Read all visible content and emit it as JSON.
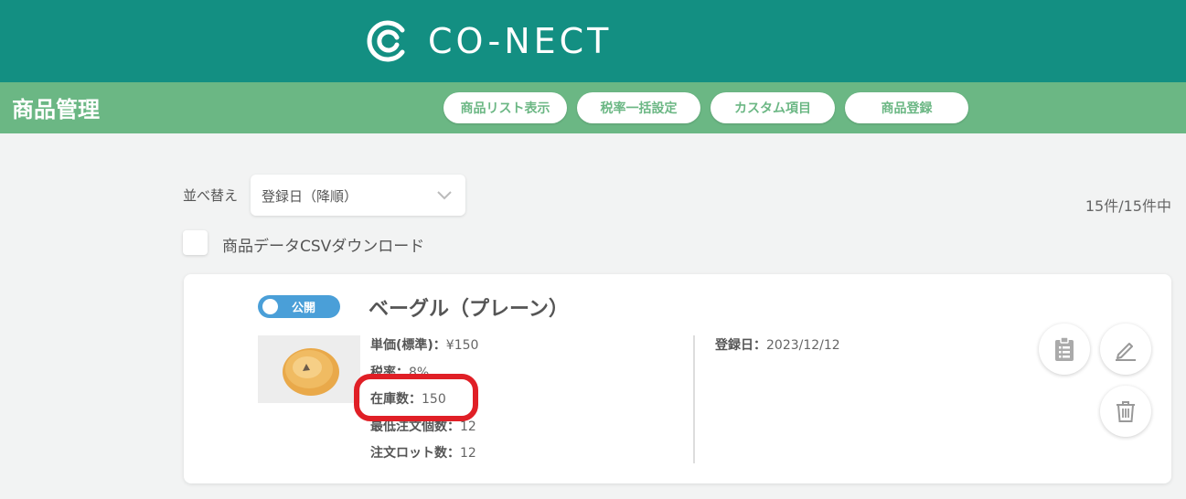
{
  "header": {
    "brand": "CO-NECT"
  },
  "subheader": {
    "title": "商品管理",
    "nav": [
      {
        "label": "商品リスト表示"
      },
      {
        "label": "税率一括設定"
      },
      {
        "label": "カスタム項目"
      },
      {
        "label": "商品登録"
      }
    ]
  },
  "toolbar": {
    "sort_label": "並べ替え",
    "sort_value": "登録日（降順）",
    "count": "15件/15件中",
    "csv_label": "商品データCSVダウンロード"
  },
  "product": {
    "status": "公開",
    "name": "ベーグル（プレーン）",
    "price_label": "単価(標準)：",
    "price_value": "¥150",
    "tax_label": "税率：",
    "tax_value": "8%",
    "stock_label": "在庫数：",
    "stock_value": "150",
    "min_order_label": "最低注文個数：",
    "min_order_value": "12",
    "lot_label": "注文ロット数：",
    "lot_value": "12",
    "reg_date_label": "登録日：",
    "reg_date_value": "2023/12/12"
  },
  "colors": {
    "header_bg": "#138f82",
    "subheader_bg": "#6bb784",
    "toggle_on": "#4a9fd8",
    "highlight": "#e01f26"
  },
  "icons": [
    "conect-logo-icon",
    "chevron-down-icon",
    "clipboard-list-icon",
    "pencil-icon",
    "trash-icon"
  ]
}
